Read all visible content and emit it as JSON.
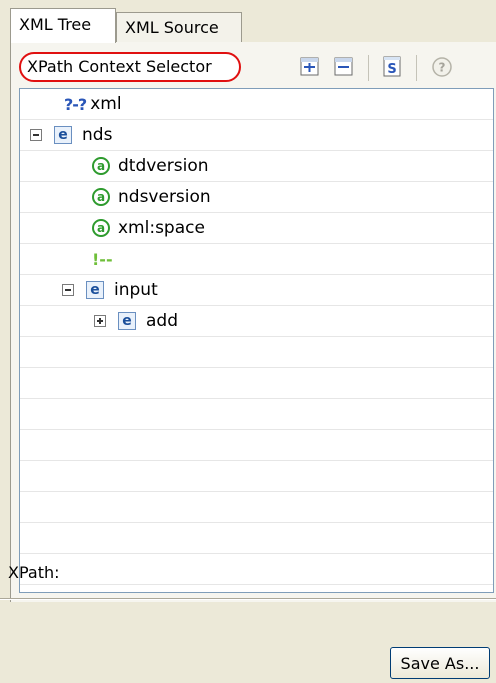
{
  "tabs": [
    {
      "label": "XML Tree",
      "active": true
    },
    {
      "label": "XML Source",
      "active": false
    }
  ],
  "toolbar": {
    "context_selector_label": "XPath Context Selector",
    "buttons": [
      "expand-all-icon",
      "collapse-all-icon",
      "schema-icon",
      "help-icon"
    ]
  },
  "tree": {
    "nodes": [
      {
        "label": "xml",
        "icon": "processing-instruction-icon",
        "icon_text": "?-?"
      },
      {
        "label": "nds",
        "icon": "element-icon",
        "expanded": true
      },
      {
        "label": "dtdversion",
        "icon": "attribute-icon"
      },
      {
        "label": "ndsversion",
        "icon": "attribute-icon"
      },
      {
        "label": "xml:space",
        "icon": "attribute-icon"
      },
      {
        "label": "",
        "icon": "comment-icon",
        "icon_text": "!--"
      },
      {
        "label": "input",
        "icon": "element-icon",
        "expanded": true
      },
      {
        "label": "add",
        "icon": "element-icon",
        "expanded": false
      }
    ]
  },
  "xpath": {
    "label": "XPath:"
  },
  "save_button": {
    "label": "Save As..."
  },
  "colors": {
    "highlight_ring": "#e01010",
    "element_icon": "#1b4f9b",
    "attribute_icon": "#2e9b2e"
  }
}
